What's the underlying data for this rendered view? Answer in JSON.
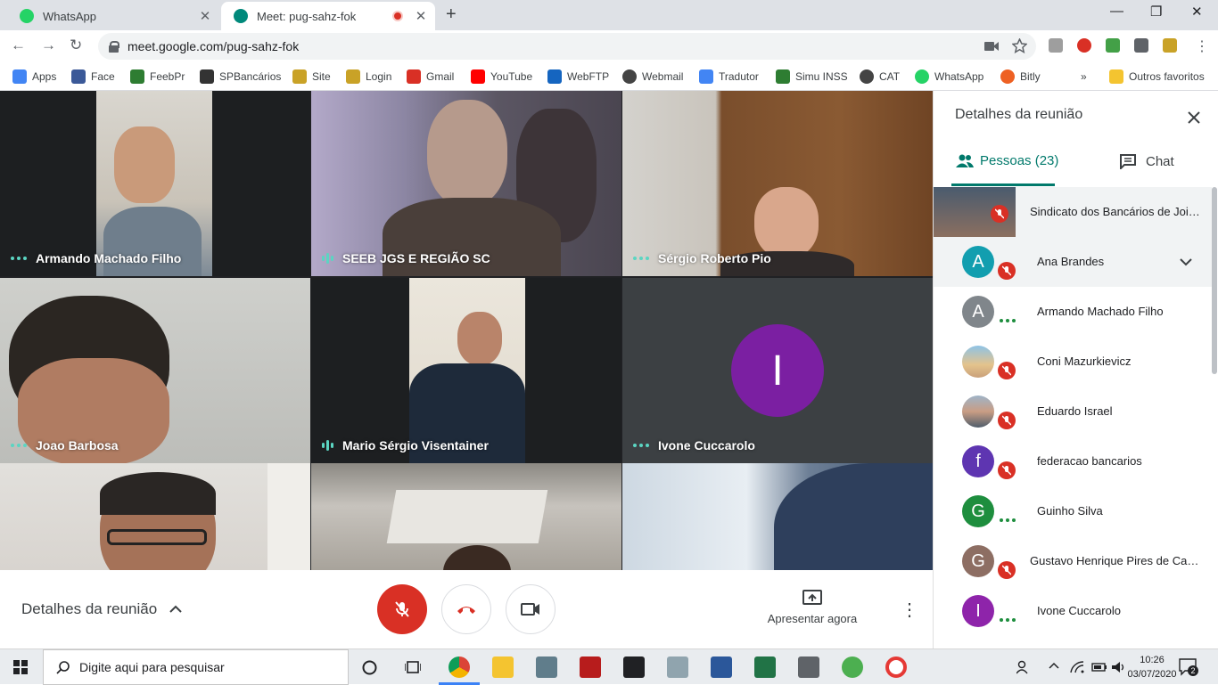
{
  "browser": {
    "tabs": [
      {
        "title": "WhatsApp",
        "close": "✕"
      },
      {
        "title": "Meet: pug-sahz-fok",
        "close": "✕"
      }
    ],
    "new_tab": "+",
    "window_controls": {
      "minimize": "—",
      "restore": "❐",
      "close": "✕"
    },
    "nav": {
      "back": "←",
      "forward": "→",
      "reload": "↻"
    },
    "url": "meet.google.com/pug-sahz-fok",
    "bookmarks": [
      {
        "label": "Apps",
        "color": "#4285f4"
      },
      {
        "label": "Face",
        "color": "#3b5998"
      },
      {
        "label": "FeebPr",
        "color": "#2e7d32"
      },
      {
        "label": "SPBancários",
        "color": "#333333"
      },
      {
        "label": "Site",
        "color": "#c9a227"
      },
      {
        "label": "Login",
        "color": "#c9a227"
      },
      {
        "label": "Gmail",
        "color": "#d93025"
      },
      {
        "label": "YouTube",
        "color": "#ff0000"
      },
      {
        "label": "WebFTP",
        "color": "#1565c0"
      },
      {
        "label": "Webmail",
        "color": "#444444"
      },
      {
        "label": "Tradutor",
        "color": "#4285f4"
      },
      {
        "label": "Simu INSS",
        "color": "#2e7d32"
      },
      {
        "label": "CAT",
        "color": "#444444"
      },
      {
        "label": "WhatsApp",
        "color": "#25d366"
      },
      {
        "label": "Bitly",
        "color": "#ee6123"
      }
    ],
    "bookmarks_overflow": "»",
    "other_bookmarks": "Outros favoritos"
  },
  "meeting": {
    "tiles": [
      {
        "name": "Armando Machado Filho",
        "indicator": "dots"
      },
      {
        "name": "SEEB JGS E REGIÃO SC",
        "indicator": "bars"
      },
      {
        "name": "Sérgio Roberto Pio",
        "indicator": "dots"
      },
      {
        "name": "Joao Barbosa",
        "indicator": "dots"
      },
      {
        "name": "Mario Sérgio Visentainer",
        "indicator": "bars"
      },
      {
        "name": "Ivone Cuccarolo",
        "indicator": "dots",
        "avatar_letter": "I"
      },
      {
        "name": "",
        "indicator": ""
      },
      {
        "name": "",
        "indicator": ""
      },
      {
        "name": "",
        "indicator": ""
      }
    ],
    "controls": {
      "details_label": "Detalhes da reunião",
      "present_label": "Apresentar agora"
    }
  },
  "panel": {
    "title": "Detalhes da reunião",
    "tabs": {
      "people": "Pessoas (23)",
      "chat": "Chat"
    },
    "people": [
      {
        "name": "Sindicato dos Bancários de Joinville",
        "avatar": "photo",
        "status": "muted"
      },
      {
        "name": "Ana Brandes",
        "avatar": "A",
        "color": "#129eaf",
        "status": "muted",
        "expand": true
      },
      {
        "name": "Armando Machado Filho",
        "avatar": "A",
        "color": "#80868b",
        "status": "talking"
      },
      {
        "name": "Coni Mazurkievicz",
        "avatar": "photo",
        "status": "muted"
      },
      {
        "name": "Eduardo Israel",
        "avatar": "photo",
        "status": "muted"
      },
      {
        "name": "federacao bancarios",
        "avatar": "f",
        "color": "#5e35b1",
        "status": "muted"
      },
      {
        "name": "Guinho Silva",
        "avatar": "G",
        "color": "#1e8e3e",
        "status": "talking"
      },
      {
        "name": "Gustavo Henrique Pires de Camargo",
        "avatar": "G",
        "color": "#8d6e63",
        "status": "muted"
      },
      {
        "name": "Ivone Cuccarolo",
        "avatar": "I",
        "color": "#8e24aa",
        "status": "talking"
      }
    ]
  },
  "taskbar": {
    "search_placeholder": "Digite aqui para pesquisar",
    "time": "10:26",
    "date": "03/07/2020",
    "notifications": "2"
  }
}
